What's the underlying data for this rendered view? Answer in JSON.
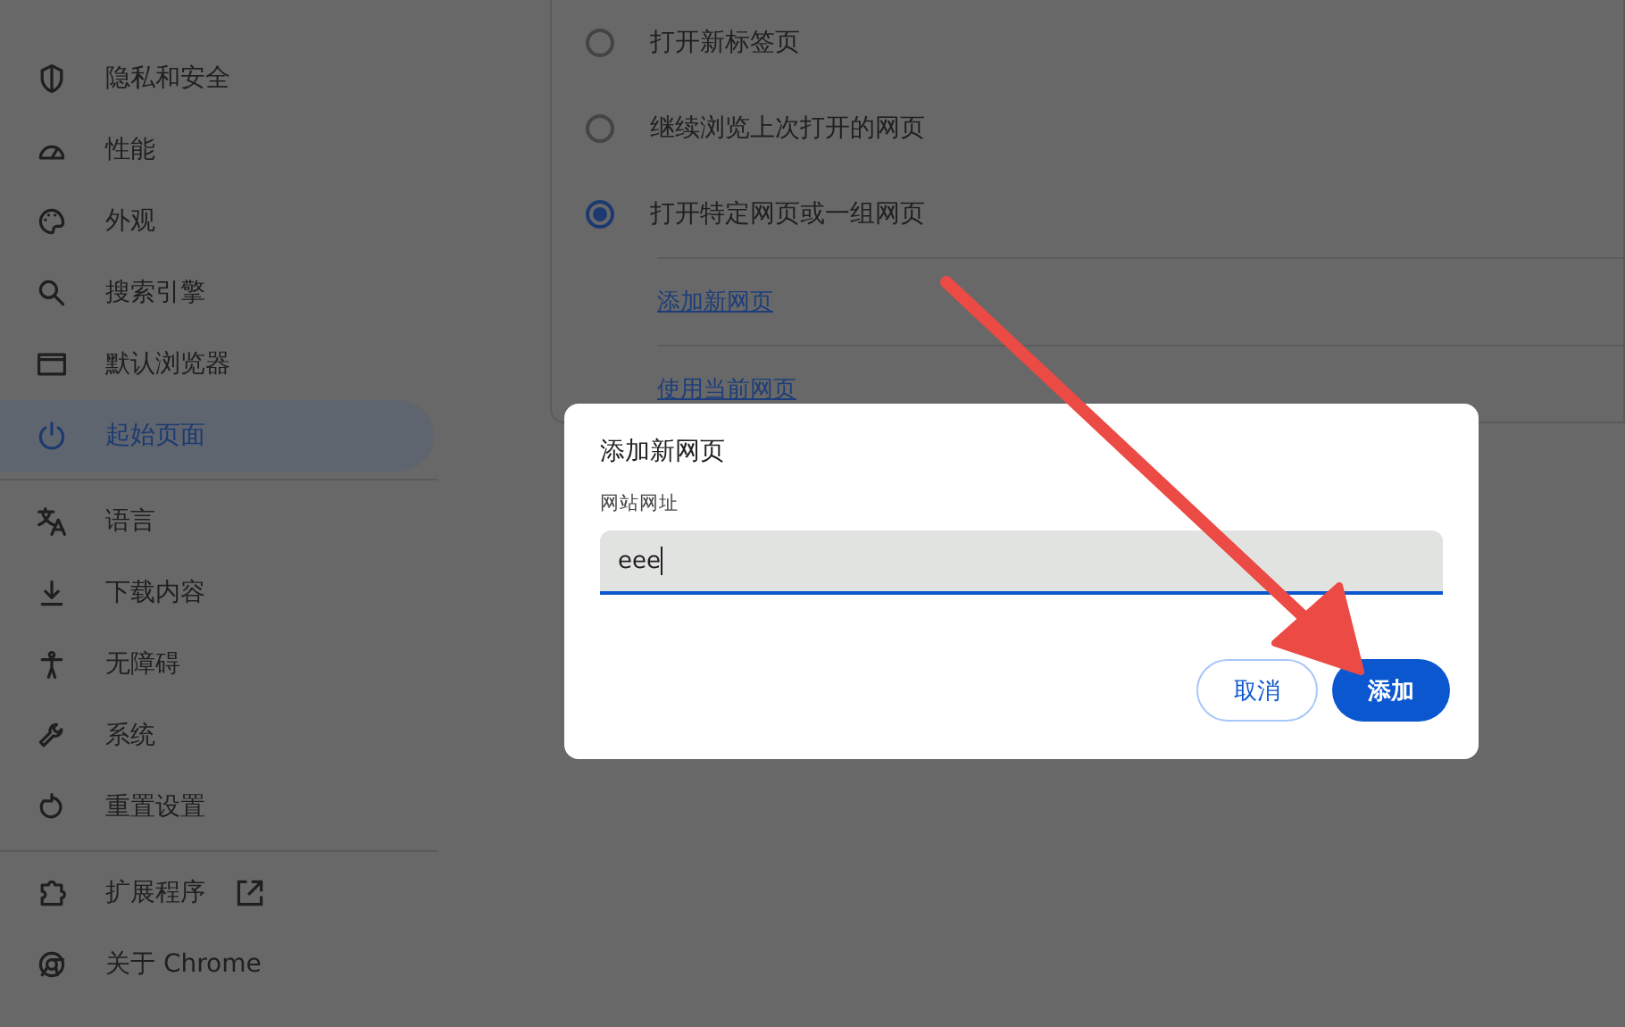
{
  "sidebar": {
    "groups": [
      [
        {
          "label": "隐私和安全",
          "selected": false
        },
        {
          "label": "性能",
          "selected": false
        },
        {
          "label": "外观",
          "selected": false
        },
        {
          "label": "搜索引擎",
          "selected": false
        },
        {
          "label": "默认浏览器",
          "selected": false
        },
        {
          "label": "起始页面",
          "selected": true
        }
      ],
      [
        {
          "label": "语言",
          "selected": false
        },
        {
          "label": "下载内容",
          "selected": false
        },
        {
          "label": "无障碍",
          "selected": false
        },
        {
          "label": "系统",
          "selected": false
        },
        {
          "label": "重置设置",
          "selected": false
        }
      ],
      [
        {
          "label": "扩展程序",
          "selected": false,
          "external_link": true
        },
        {
          "label": "关于 Chrome",
          "selected": false,
          "external_link": false
        }
      ]
    ]
  },
  "startup": {
    "options": [
      {
        "label": "打开新标签页",
        "selected": false
      },
      {
        "label": "继续浏览上次打开的网页",
        "selected": false
      },
      {
        "label": "打开特定网页或一组网页",
        "selected": true
      }
    ],
    "links": [
      "添加新网页",
      "使用当前网页"
    ]
  },
  "dialog": {
    "title": "添加新网页",
    "field": {
      "label": "网站网址",
      "value": "eee",
      "focused": true
    },
    "buttons": [
      {
        "label": "取消",
        "kind": "secondary"
      },
      {
        "label": "添加",
        "kind": "primary"
      }
    ]
  }
}
